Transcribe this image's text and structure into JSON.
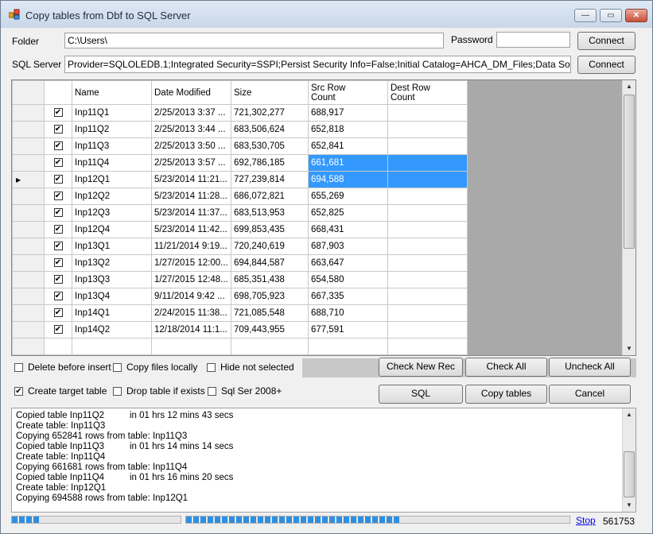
{
  "window": {
    "title": "Copy tables from Dbf to SQL Server",
    "min": "—",
    "max": "▭",
    "close": "✕"
  },
  "form": {
    "folder_label": "Folder",
    "folder_value": "C:\\Users\\",
    "password_label": "Password",
    "password_value": "",
    "connect_label": "Connect",
    "sqlserver_label": "SQL Server",
    "sqlserver_value": "Provider=SQLOLEDB.1;Integrated Security=SSPI;Persist Security Info=False;Initial Catalog=AHCA_DM_Files;Data Source=dmreporting",
    "connect2_label": "Connect"
  },
  "grid": {
    "headers": [
      "Name",
      "Date Modified",
      "Size",
      "Src Row\nCount",
      "Dest Row\nCount"
    ],
    "current_row_marker": "▶",
    "rows": [
      {
        "checked": true,
        "name": "Inp11Q1",
        "date": "2/25/2013 3:37 ...",
        "size": "721,302,277",
        "src": "688,917",
        "dest": "",
        "selected": false,
        "current": false
      },
      {
        "checked": true,
        "name": "Inp11Q2",
        "date": "2/25/2013 3:44 ...",
        "size": "683,506,624",
        "src": "652,818",
        "dest": "",
        "selected": false,
        "current": false
      },
      {
        "checked": true,
        "name": "Inp11Q3",
        "date": "2/25/2013 3:50 ...",
        "size": "683,530,705",
        "src": "652,841",
        "dest": "",
        "selected": false,
        "current": false
      },
      {
        "checked": true,
        "name": "Inp11Q4",
        "date": "2/25/2013 3:57 ...",
        "size": "692,786,185",
        "src": "661,681",
        "dest": "",
        "selected": true,
        "current": false
      },
      {
        "checked": true,
        "name": "Inp12Q1",
        "date": "5/23/2014 11:21...",
        "size": "727,239,814",
        "src": "694,588",
        "dest": "",
        "selected": true,
        "current": true
      },
      {
        "checked": true,
        "name": "Inp12Q2",
        "date": "5/23/2014 11:28...",
        "size": "686,072,821",
        "src": "655,269",
        "dest": "",
        "selected": false,
        "current": false
      },
      {
        "checked": true,
        "name": "Inp12Q3",
        "date": "5/23/2014 11:37...",
        "size": "683,513,953",
        "src": "652,825",
        "dest": "",
        "selected": false,
        "current": false
      },
      {
        "checked": true,
        "name": "Inp12Q4",
        "date": "5/23/2014 11:42...",
        "size": "699,853,435",
        "src": "668,431",
        "dest": "",
        "selected": false,
        "current": false
      },
      {
        "checked": true,
        "name": "Inp13Q1",
        "date": "11/21/2014 9:19...",
        "size": "720,240,619",
        "src": "687,903",
        "dest": "",
        "selected": false,
        "current": false
      },
      {
        "checked": true,
        "name": "Inp13Q2",
        "date": "1/27/2015 12:00...",
        "size": "694,844,587",
        "src": "663,647",
        "dest": "",
        "selected": false,
        "current": false
      },
      {
        "checked": true,
        "name": "Inp13Q3",
        "date": "1/27/2015 12:48...",
        "size": "685,351,438",
        "src": "654,580",
        "dest": "",
        "selected": false,
        "current": false
      },
      {
        "checked": true,
        "name": "Inp13Q4",
        "date": "9/11/2014 9:42 ...",
        "size": "698,705,923",
        "src": "667,335",
        "dest": "",
        "selected": false,
        "current": false
      },
      {
        "checked": true,
        "name": "Inp14Q1",
        "date": "2/24/2015 11:38...",
        "size": "721,085,548",
        "src": "688,710",
        "dest": "",
        "selected": false,
        "current": false
      },
      {
        "checked": true,
        "name": "Inp14Q2",
        "date": "12/18/2014 11:1...",
        "size": "709,443,955",
        "src": "677,591",
        "dest": "",
        "selected": false,
        "current": false
      }
    ],
    "scroll_up": "▲",
    "scroll_down": "▼"
  },
  "options": {
    "delete_before_insert": {
      "label": "Delete before insert",
      "checked": false
    },
    "copy_files_locally": {
      "label": "Copy files locally",
      "checked": false
    },
    "hide_not_selected": {
      "label": "Hide not selected",
      "checked": false
    },
    "create_target_table": {
      "label": "Create target table",
      "checked": true
    },
    "drop_table_if_exists": {
      "label": "Drop table if exists",
      "checked": false
    },
    "sql_ser_2008": {
      "label": "Sql Ser 2008+",
      "checked": false
    }
  },
  "buttons": {
    "check_new_rec": "Check New Rec",
    "check_all": "Check All",
    "uncheck_all": "Uncheck All",
    "sql": "SQL",
    "copy_tables": "Copy tables",
    "cancel": "Cancel"
  },
  "log": {
    "lines": [
      "Copied table Inp11Q2          in 01 hrs 12 mins 43 secs",
      "Create table: Inp11Q3",
      "Copying 652841 rows from table: Inp11Q3",
      "Copied table Inp11Q3          in 01 hrs 14 mins 14 secs",
      "Create table: Inp11Q4",
      "Copying 661681 rows from table: Inp11Q4",
      "Copied table Inp11Q4          in 01 hrs 16 mins 20 secs",
      "Create table: Inp12Q1",
      "Copying 694588 rows from table: Inp12Q1"
    ]
  },
  "status": {
    "progress1_fraction": 0.17,
    "progress2_fraction": 0.56,
    "stop_label": "Stop",
    "count": "561753"
  },
  "colors": {
    "selection": "#3399ff",
    "progress": "#2f8fe0"
  }
}
